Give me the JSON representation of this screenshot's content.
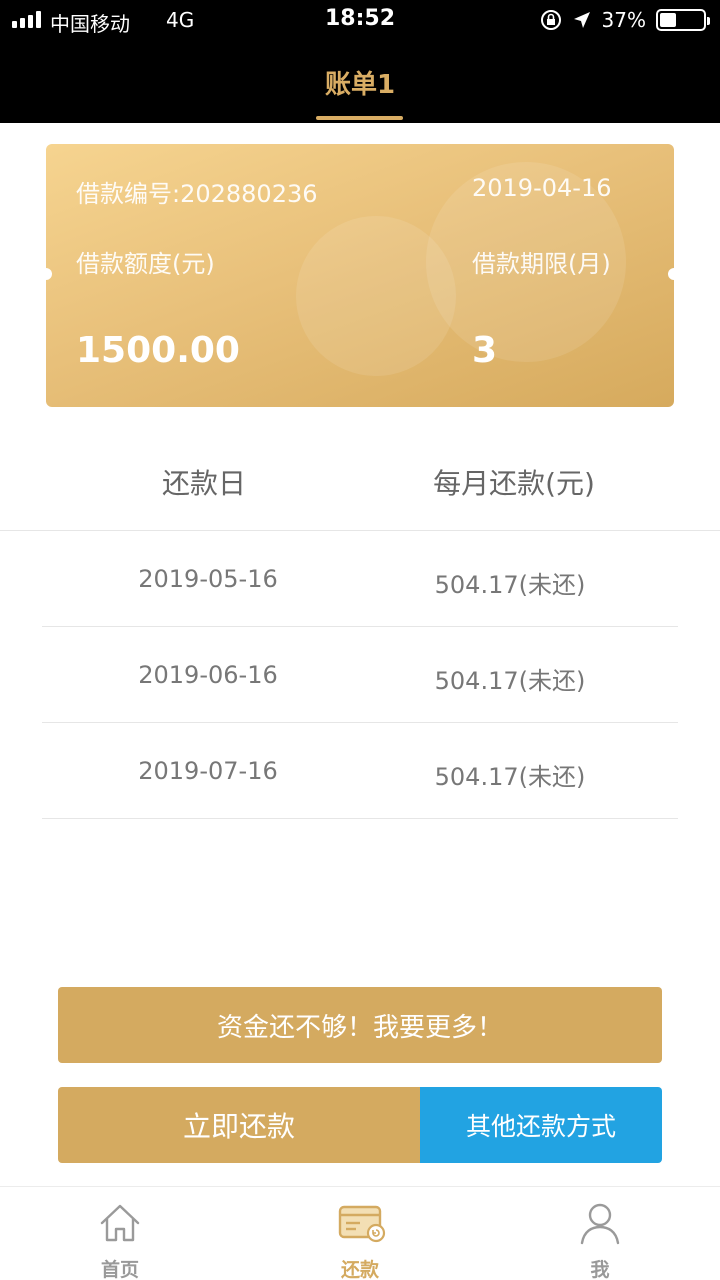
{
  "status_bar": {
    "carrier": "中国移动",
    "network": "4G",
    "time": "18:52",
    "battery": "37%",
    "battery_level": 0.37
  },
  "header": {
    "title": "账单1"
  },
  "loan_card": {
    "loan_no": "借款编号:202880236",
    "date": "2019-04-16",
    "amount_label": "借款额度(元)",
    "term_label": "借款期限(月)",
    "amount_value": "1500.00",
    "term_value": "3"
  },
  "schedule": {
    "headers": [
      "还款日",
      "每月还款(元)"
    ],
    "rows": [
      {
        "date": "2019-05-16",
        "amount": "504.17(未还)"
      },
      {
        "date": "2019-06-16",
        "amount": "504.17(未还)"
      },
      {
        "date": "2019-07-16",
        "amount": "504.17(未还)"
      }
    ]
  },
  "buttons": {
    "more_funds": "资金还不够！我要更多！",
    "pay_now": "立即还款",
    "other_methods": "其他还款方式"
  },
  "tabbar": {
    "items": [
      {
        "label": "首页",
        "icon": "home-icon",
        "active": false
      },
      {
        "label": "还款",
        "icon": "repay-card-icon",
        "active": true
      },
      {
        "label": "我",
        "icon": "user-icon",
        "active": false
      }
    ]
  },
  "colors": {
    "gold": "#d4aa60",
    "blue": "#22a3e2",
    "header_bg": "#000000"
  }
}
